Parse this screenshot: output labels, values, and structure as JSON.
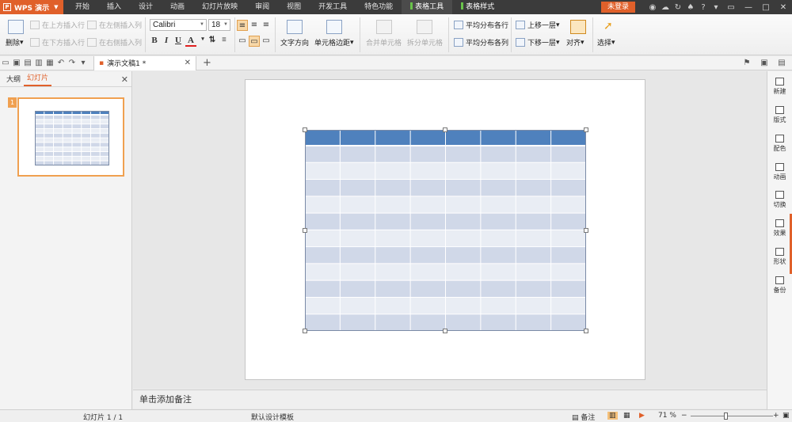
{
  "app": {
    "name": "WPS 演示",
    "logo": "P"
  },
  "menu": {
    "items": [
      "开始",
      "插入",
      "设计",
      "动画",
      "幻灯片放映",
      "审阅",
      "视图",
      "开发工具",
      "特色功能"
    ],
    "active_items": [
      "表格工具",
      "表格样式"
    ],
    "login": "未登录"
  },
  "ribbon": {
    "delete": "删除",
    "insert_above": "在上方插入行",
    "insert_below": "在下方插入行",
    "insert_left": "在左侧插入列",
    "insert_right": "在右侧插入列",
    "font_name": "Calibri",
    "font_size": "18",
    "bold": "B",
    "italic": "I",
    "underline": "U",
    "font_color": "A",
    "text_direction": "文字方向",
    "cell_margin": "单元格边距",
    "merge_cells": "合并单元格",
    "split_cells": "拆分单元格",
    "distribute_rows": "平均分布各行",
    "distribute_cols": "平均分布各列",
    "bring_forward": "上移一层",
    "send_backward": "下移一层",
    "align": "对齐",
    "select": "选择"
  },
  "doc_tab": {
    "title": "演示文稿1 *"
  },
  "left_panel": {
    "tab_outline": "大纲",
    "tab_slides": "幻灯片",
    "slide_number": "1"
  },
  "notes": {
    "placeholder": "单击添加备注"
  },
  "right_bar": [
    "新建",
    "版式",
    "配色",
    "动画",
    "切换",
    "效果",
    "形状",
    "备份"
  ],
  "status": {
    "slide_info": "幻灯片 1 / 1",
    "template": "默认设计模板",
    "notes": "备注",
    "zoom": "71 %",
    "zoom_value": 0.71
  },
  "table": {
    "columns": 8,
    "rows": 12,
    "header_color": "#4f81bd",
    "band_dark": "#d0d8e8",
    "band_light": "#e9edf4"
  },
  "colors": {
    "accent": "#e0602a",
    "menubar": "#3b3b3b",
    "active_tab_mark": "#69c34a"
  }
}
